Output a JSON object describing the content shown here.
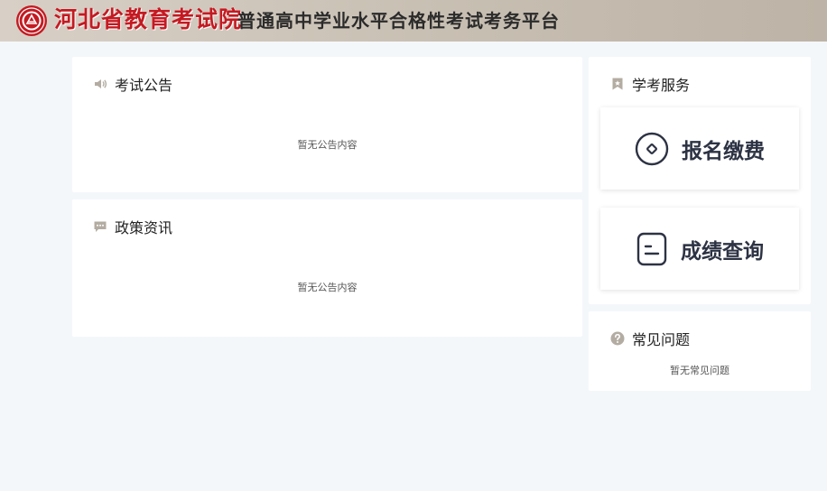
{
  "header": {
    "brand": "河北省教育考试院",
    "platform": "普通高中学业水平合格性考试考务平台"
  },
  "notices": {
    "title": "考试公告",
    "empty": "暂无公告内容"
  },
  "policy": {
    "title": "政策资讯",
    "empty": "暂无公告内容"
  },
  "services": {
    "title": "学考服务",
    "register_pay": "报名缴费",
    "score_query": "成绩查询"
  },
  "faq": {
    "title": "常见问题",
    "empty": "暂无常见问题"
  },
  "colors": {
    "brand_red": "#c41a22",
    "page_bg": "#f4f7fa",
    "header_bg": "#c9c0b4",
    "icon_gray": "#b3aca2"
  }
}
